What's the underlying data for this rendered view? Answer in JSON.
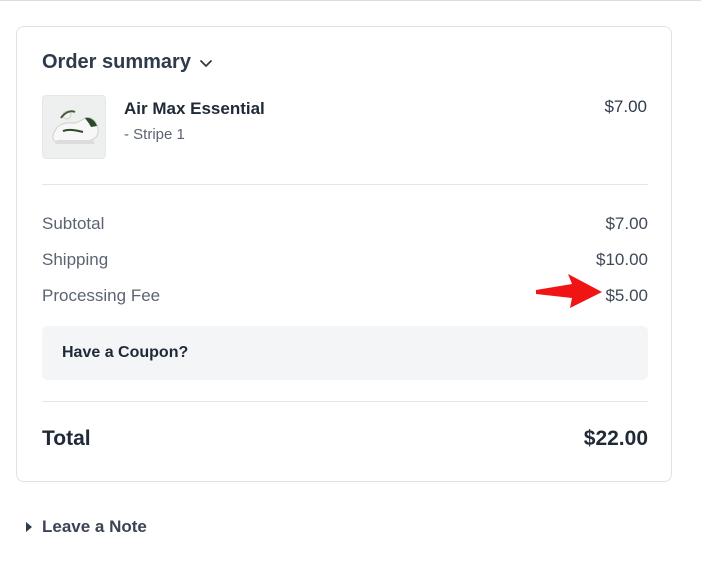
{
  "order_summary": {
    "heading": "Order summary",
    "product": {
      "name": "Air Max Essential",
      "variant": "- Stripe 1",
      "price": "$7.00"
    },
    "rows": [
      {
        "label": "Subtotal",
        "value": "$7.00"
      },
      {
        "label": "Shipping",
        "value": "$10.00"
      },
      {
        "label": "Processing Fee",
        "value": "$5.00"
      }
    ],
    "coupon_label": "Have a Coupon?",
    "total_label": "Total",
    "total_value": "$22.00"
  },
  "note_link": "Leave a Note",
  "colors": {
    "accent_arrow": "#f01414",
    "text_dark": "#1f2937",
    "text_muted": "#5b6472",
    "coupon_bg": "#f3f5f7"
  },
  "icons": [
    "chevron-down-icon",
    "caret-right-icon",
    "red-arrow-annotation",
    "sneaker-thumbnail"
  ]
}
